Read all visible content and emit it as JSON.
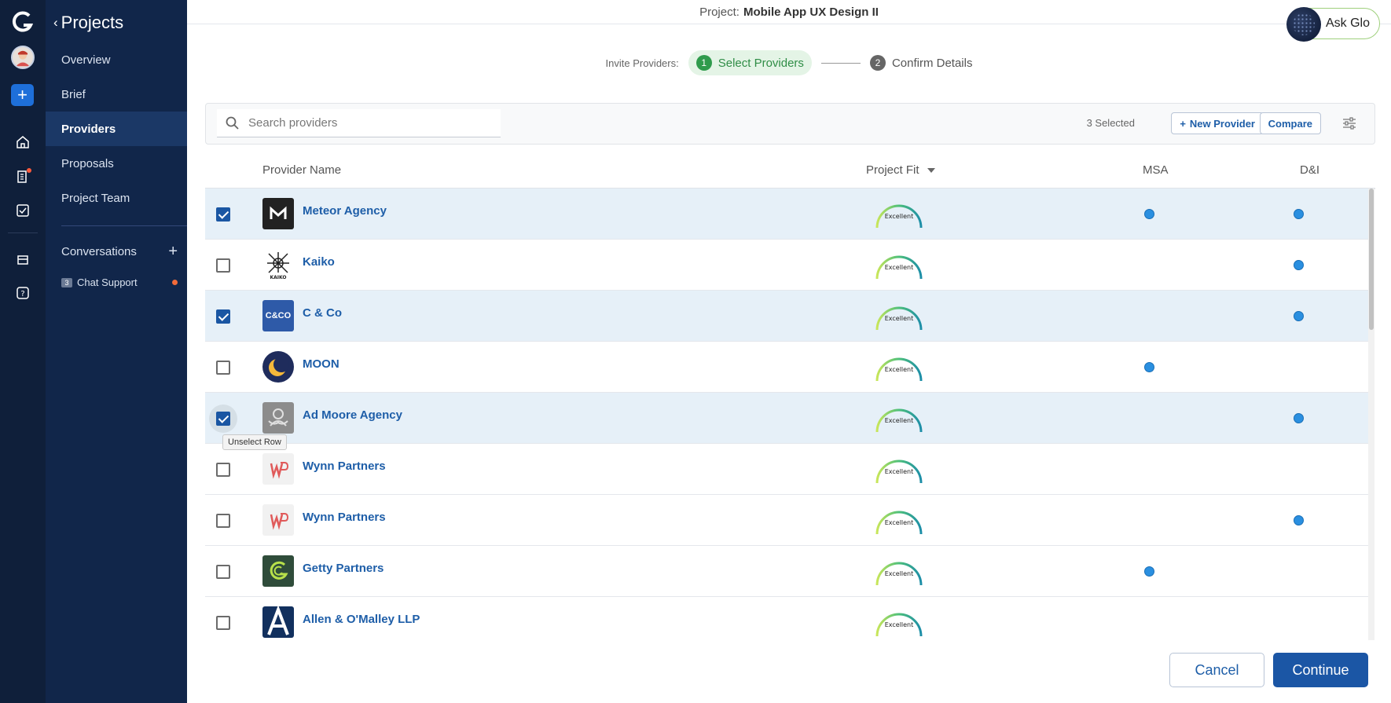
{
  "nav": {
    "back_label": "Projects",
    "items": [
      {
        "label": "Overview",
        "active": false
      },
      {
        "label": "Brief",
        "active": false
      },
      {
        "label": "Providers",
        "active": true
      },
      {
        "label": "Proposals",
        "active": false
      },
      {
        "label": "Project Team",
        "active": false
      }
    ],
    "conversations_label": "Conversations",
    "chat": {
      "badge": "3",
      "label": "Chat Support"
    }
  },
  "header": {
    "project_prefix": "Project:",
    "project_name": "Mobile App UX Design II",
    "ask_glo_label": "Ask Glo"
  },
  "steps": {
    "label": "Invite Providers:",
    "step1": {
      "num": "1",
      "label": "Select Providers"
    },
    "step2": {
      "num": "2",
      "label": "Confirm Details"
    }
  },
  "toolbar": {
    "search_placeholder": "Search providers",
    "selected_count": "3 Selected",
    "new_provider_label": "New Provider",
    "compare_label": "Compare"
  },
  "table": {
    "columns": [
      "Provider Name",
      "Project Fit",
      "MSA",
      "D&I"
    ],
    "rows": [
      {
        "name": "Meteor Agency",
        "fit": "Excellent",
        "selected": true,
        "msa": true,
        "dni": true,
        "logo": "meteor"
      },
      {
        "name": "Kaiko",
        "fit": "Excellent",
        "selected": false,
        "msa": false,
        "dni": true,
        "logo": "kaiko"
      },
      {
        "name": "C & Co",
        "fit": "Excellent",
        "selected": true,
        "msa": false,
        "dni": true,
        "logo": "cco"
      },
      {
        "name": "MOON",
        "fit": "Excellent",
        "selected": false,
        "msa": true,
        "dni": false,
        "logo": "moon"
      },
      {
        "name": "Ad Moore Agency",
        "fit": "Excellent",
        "selected": true,
        "msa": false,
        "dni": true,
        "logo": "admoore"
      },
      {
        "name": "Wynn Partners",
        "fit": "Excellent",
        "selected": false,
        "msa": false,
        "dni": false,
        "logo": "wynn"
      },
      {
        "name": "Wynn Partners",
        "fit": "Excellent",
        "selected": false,
        "msa": false,
        "dni": true,
        "logo": "wynn"
      },
      {
        "name": "Getty Partners",
        "fit": "Excellent",
        "selected": false,
        "msa": true,
        "dni": false,
        "logo": "getty"
      },
      {
        "name": "Allen & O'Malley LLP",
        "fit": "Excellent",
        "selected": false,
        "msa": false,
        "dni": false,
        "logo": "allen"
      }
    ],
    "logo_text": {
      "kaiko": "KAIKO",
      "cco": "C&CO"
    }
  },
  "tooltip": "Unselect Row",
  "footer": {
    "cancel_label": "Cancel",
    "continue_label": "Continue"
  },
  "colors": {
    "accent": "#1b56a5",
    "nav_bg": "#11264a",
    "rail_bg": "#0f1f3a",
    "selected_row": "#e6f0f8",
    "step_active": "#2f9b4c"
  }
}
